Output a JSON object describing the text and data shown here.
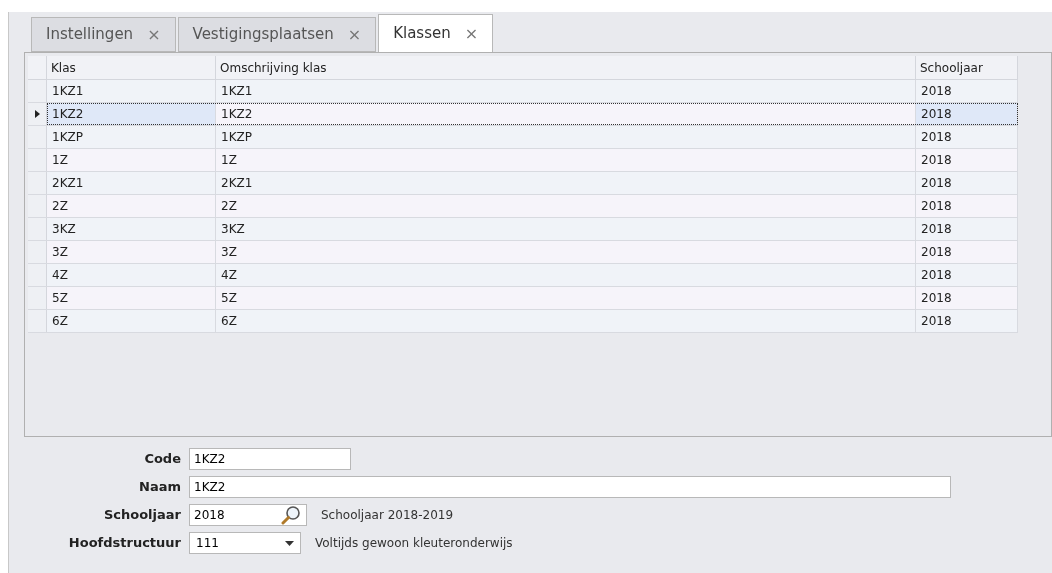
{
  "tabs": [
    {
      "label": "Instellingen",
      "close": "×",
      "selected": false
    },
    {
      "label": "Vestigingsplaatsen",
      "close": "×",
      "selected": false
    },
    {
      "label": "Klassen",
      "close": "×",
      "selected": true
    }
  ],
  "table": {
    "columns": [
      "Klas",
      "Omschrijving klas",
      "Schooljaar"
    ],
    "rows": [
      {
        "cells": [
          "1KZ1",
          "1KZ1",
          "2018"
        ],
        "selected": false
      },
      {
        "cells": [
          "1KZ2",
          "1KZ2",
          "2018"
        ],
        "selected": true
      },
      {
        "cells": [
          "1KZP",
          "1KZP",
          "2018"
        ],
        "selected": false
      },
      {
        "cells": [
          "1Z",
          "1Z",
          "2018"
        ],
        "selected": false
      },
      {
        "cells": [
          "2KZ1",
          "2KZ1",
          "2018"
        ],
        "selected": false
      },
      {
        "cells": [
          "2Z",
          "2Z",
          "2018"
        ],
        "selected": false
      },
      {
        "cells": [
          "3KZ",
          "3KZ",
          "2018"
        ],
        "selected": false
      },
      {
        "cells": [
          "3Z",
          "3Z",
          "2018"
        ],
        "selected": false
      },
      {
        "cells": [
          "4Z",
          "4Z",
          "2018"
        ],
        "selected": false
      },
      {
        "cells": [
          "5Z",
          "5Z",
          "2018"
        ],
        "selected": false
      },
      {
        "cells": [
          "6Z",
          "6Z",
          "2018"
        ],
        "selected": false
      }
    ]
  },
  "form": [
    {
      "kind": "text",
      "label": "Code",
      "value": "1KZ2"
    },
    {
      "kind": "widetext",
      "label": "Naam",
      "value": "1KZ2"
    },
    {
      "kind": "lookup",
      "label": "Schooljaar",
      "value": "2018",
      "description": "Schooljaar 2018-2019"
    },
    {
      "kind": "dropdown",
      "label": "Hoofdstructuur",
      "value": "111",
      "description": "Voltijds gewoon kleuteronderwijs"
    }
  ]
}
